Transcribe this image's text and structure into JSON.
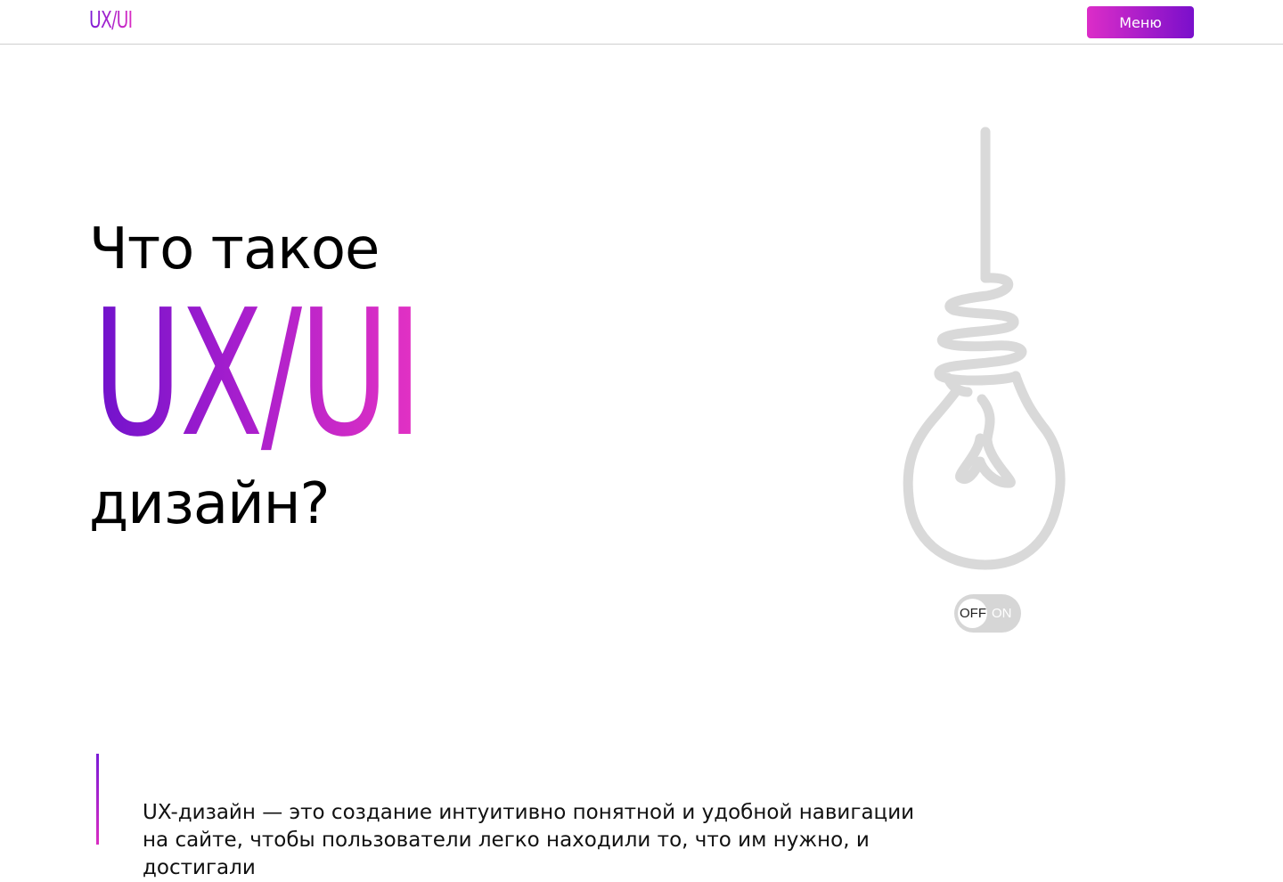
{
  "header": {
    "logo": "UX/UI",
    "menu_label": "Меню"
  },
  "hero": {
    "line1": "Что такое",
    "highlight": "UX/UI",
    "line3": "дизайн?"
  },
  "lamp": {
    "icon": "lightbulb-icon",
    "state": "off",
    "off_label": "OFF",
    "on_label": "ON"
  },
  "intro": {
    "text": "UX-дизайн — это создание интуитивно понятной и удобной навигации на сайте, чтобы пользователи легко находили то, что им нужно, и достигали"
  },
  "colors": {
    "accent_start": "#7a1bd6",
    "accent_end": "#d92cc2",
    "bulb_stroke": "#d9d9d9",
    "toggle_bg": "#d6d6d6"
  }
}
